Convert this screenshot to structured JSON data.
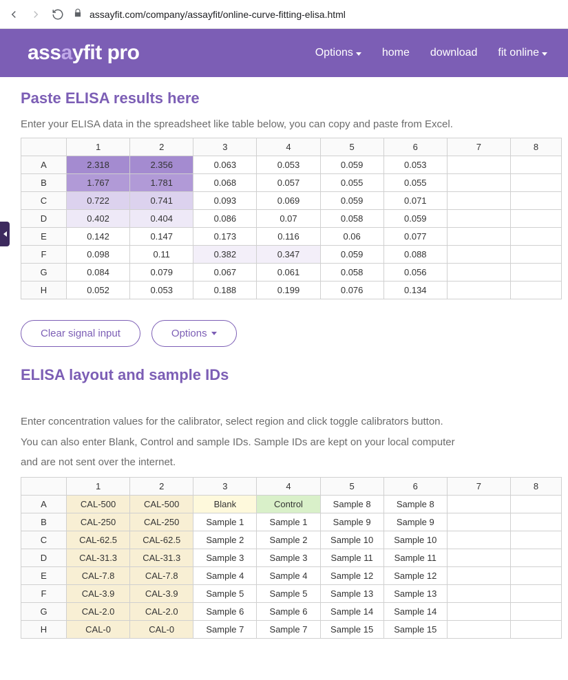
{
  "browser": {
    "url": "assayfit.com/company/assayfit/online-curve-fitting-elisa.html"
  },
  "header": {
    "logo_pre": "ass",
    "logo_mid": "a",
    "logo_post": "yfit pro",
    "nav": [
      "Options",
      "home",
      "download",
      "fit online"
    ]
  },
  "section1": {
    "title": "Paste ELISA results here",
    "desc": "Enter your ELISA data in the spreadsheet like table below, you can copy and paste from Excel."
  },
  "table1": {
    "cols": [
      "1",
      "2",
      "3",
      "4",
      "5",
      "6",
      "7",
      "8"
    ],
    "rows": [
      "A",
      "B",
      "C",
      "D",
      "E",
      "F",
      "G",
      "H"
    ],
    "cells": [
      [
        "2.318",
        "2.356",
        "0.063",
        "0.053",
        "0.059",
        "0.053",
        "",
        ""
      ],
      [
        "1.767",
        "1.781",
        "0.068",
        "0.057",
        "0.055",
        "0.055",
        "",
        ""
      ],
      [
        "0.722",
        "0.741",
        "0.093",
        "0.069",
        "0.059",
        "0.071",
        "",
        ""
      ],
      [
        "0.402",
        "0.404",
        "0.086",
        "0.07",
        "0.058",
        "0.059",
        "",
        ""
      ],
      [
        "0.142",
        "0.147",
        "0.173",
        "0.116",
        "0.06",
        "0.077",
        "",
        ""
      ],
      [
        "0.098",
        "0.11",
        "0.382",
        "0.347",
        "0.059",
        "0.088",
        "",
        ""
      ],
      [
        "0.084",
        "0.079",
        "0.067",
        "0.061",
        "0.058",
        "0.056",
        "",
        ""
      ],
      [
        "0.052",
        "0.053",
        "0.188",
        "0.199",
        "0.076",
        "0.134",
        "",
        ""
      ]
    ],
    "shades": [
      [
        "shade-a",
        "shade-a",
        "",
        "",
        "",
        "",
        "",
        ""
      ],
      [
        "shade-b",
        "shade-b",
        "",
        "",
        "",
        "",
        "",
        ""
      ],
      [
        "shade-c",
        "shade-c",
        "",
        "",
        "",
        "",
        "",
        ""
      ],
      [
        "shade-d",
        "shade-d",
        "",
        "",
        "",
        "",
        "",
        ""
      ],
      [
        "",
        "",
        "",
        "",
        "",
        "",
        "",
        ""
      ],
      [
        "",
        "",
        "shade-f1",
        "shade-f1",
        "",
        "",
        "",
        ""
      ],
      [
        "",
        "",
        "",
        "",
        "",
        "",
        "",
        ""
      ],
      [
        "",
        "",
        "",
        "",
        "",
        "",
        "",
        ""
      ]
    ]
  },
  "buttons": {
    "clear": "Clear signal input",
    "options": "Options"
  },
  "section2": {
    "title": "ELISA layout and sample IDs",
    "desc1": "Enter concentration values for the calibrator, select region and click toggle calibrators button.",
    "desc2": "You can also enter Blank, Control and sample IDs. Sample IDs are kept on your local computer",
    "desc3": "and are not sent over the internet."
  },
  "table2": {
    "cols": [
      "1",
      "2",
      "3",
      "4",
      "5",
      "6",
      "7",
      "8"
    ],
    "rows": [
      "A",
      "B",
      "C",
      "D",
      "E",
      "F",
      "G",
      "H"
    ],
    "cells": [
      [
        "CAL-500",
        "CAL-500",
        "Blank",
        "Control",
        "Sample 8",
        "Sample 8",
        "",
        ""
      ],
      [
        "CAL-250",
        "CAL-250",
        "Sample 1",
        "Sample 1",
        "Sample 9",
        "Sample 9",
        "",
        ""
      ],
      [
        "CAL-62.5",
        "CAL-62.5",
        "Sample 2",
        "Sample 2",
        "Sample 10",
        "Sample 10",
        "",
        ""
      ],
      [
        "CAL-31.3",
        "CAL-31.3",
        "Sample 3",
        "Sample 3",
        "Sample 11",
        "Sample 11",
        "",
        ""
      ],
      [
        "CAL-7.8",
        "CAL-7.8",
        "Sample 4",
        "Sample 4",
        "Sample 12",
        "Sample 12",
        "",
        ""
      ],
      [
        "CAL-3.9",
        "CAL-3.9",
        "Sample 5",
        "Sample 5",
        "Sample 13",
        "Sample 13",
        "",
        ""
      ],
      [
        "CAL-2.0",
        "CAL-2.0",
        "Sample 6",
        "Sample 6",
        "Sample 14",
        "Sample 14",
        "",
        ""
      ],
      [
        "CAL-0",
        "CAL-0",
        "Sample 7",
        "Sample 7",
        "Sample 15",
        "Sample 15",
        "",
        ""
      ]
    ],
    "shades": [
      [
        "cal-cell",
        "cal-cell",
        "blank-cell",
        "control-cell",
        "",
        "",
        "",
        ""
      ],
      [
        "cal-cell",
        "cal-cell",
        "",
        "",
        "",
        "",
        "",
        ""
      ],
      [
        "cal-cell",
        "cal-cell",
        "",
        "",
        "",
        "",
        "",
        ""
      ],
      [
        "cal-cell",
        "cal-cell",
        "",
        "",
        "",
        "",
        "",
        ""
      ],
      [
        "cal-cell",
        "cal-cell",
        "",
        "",
        "",
        "",
        "",
        ""
      ],
      [
        "cal-cell",
        "cal-cell",
        "",
        "",
        "",
        "",
        "",
        ""
      ],
      [
        "cal-cell",
        "cal-cell",
        "",
        "",
        "",
        "",
        "",
        ""
      ],
      [
        "cal-cell",
        "cal-cell",
        "",
        "",
        "",
        "",
        "",
        ""
      ]
    ]
  }
}
